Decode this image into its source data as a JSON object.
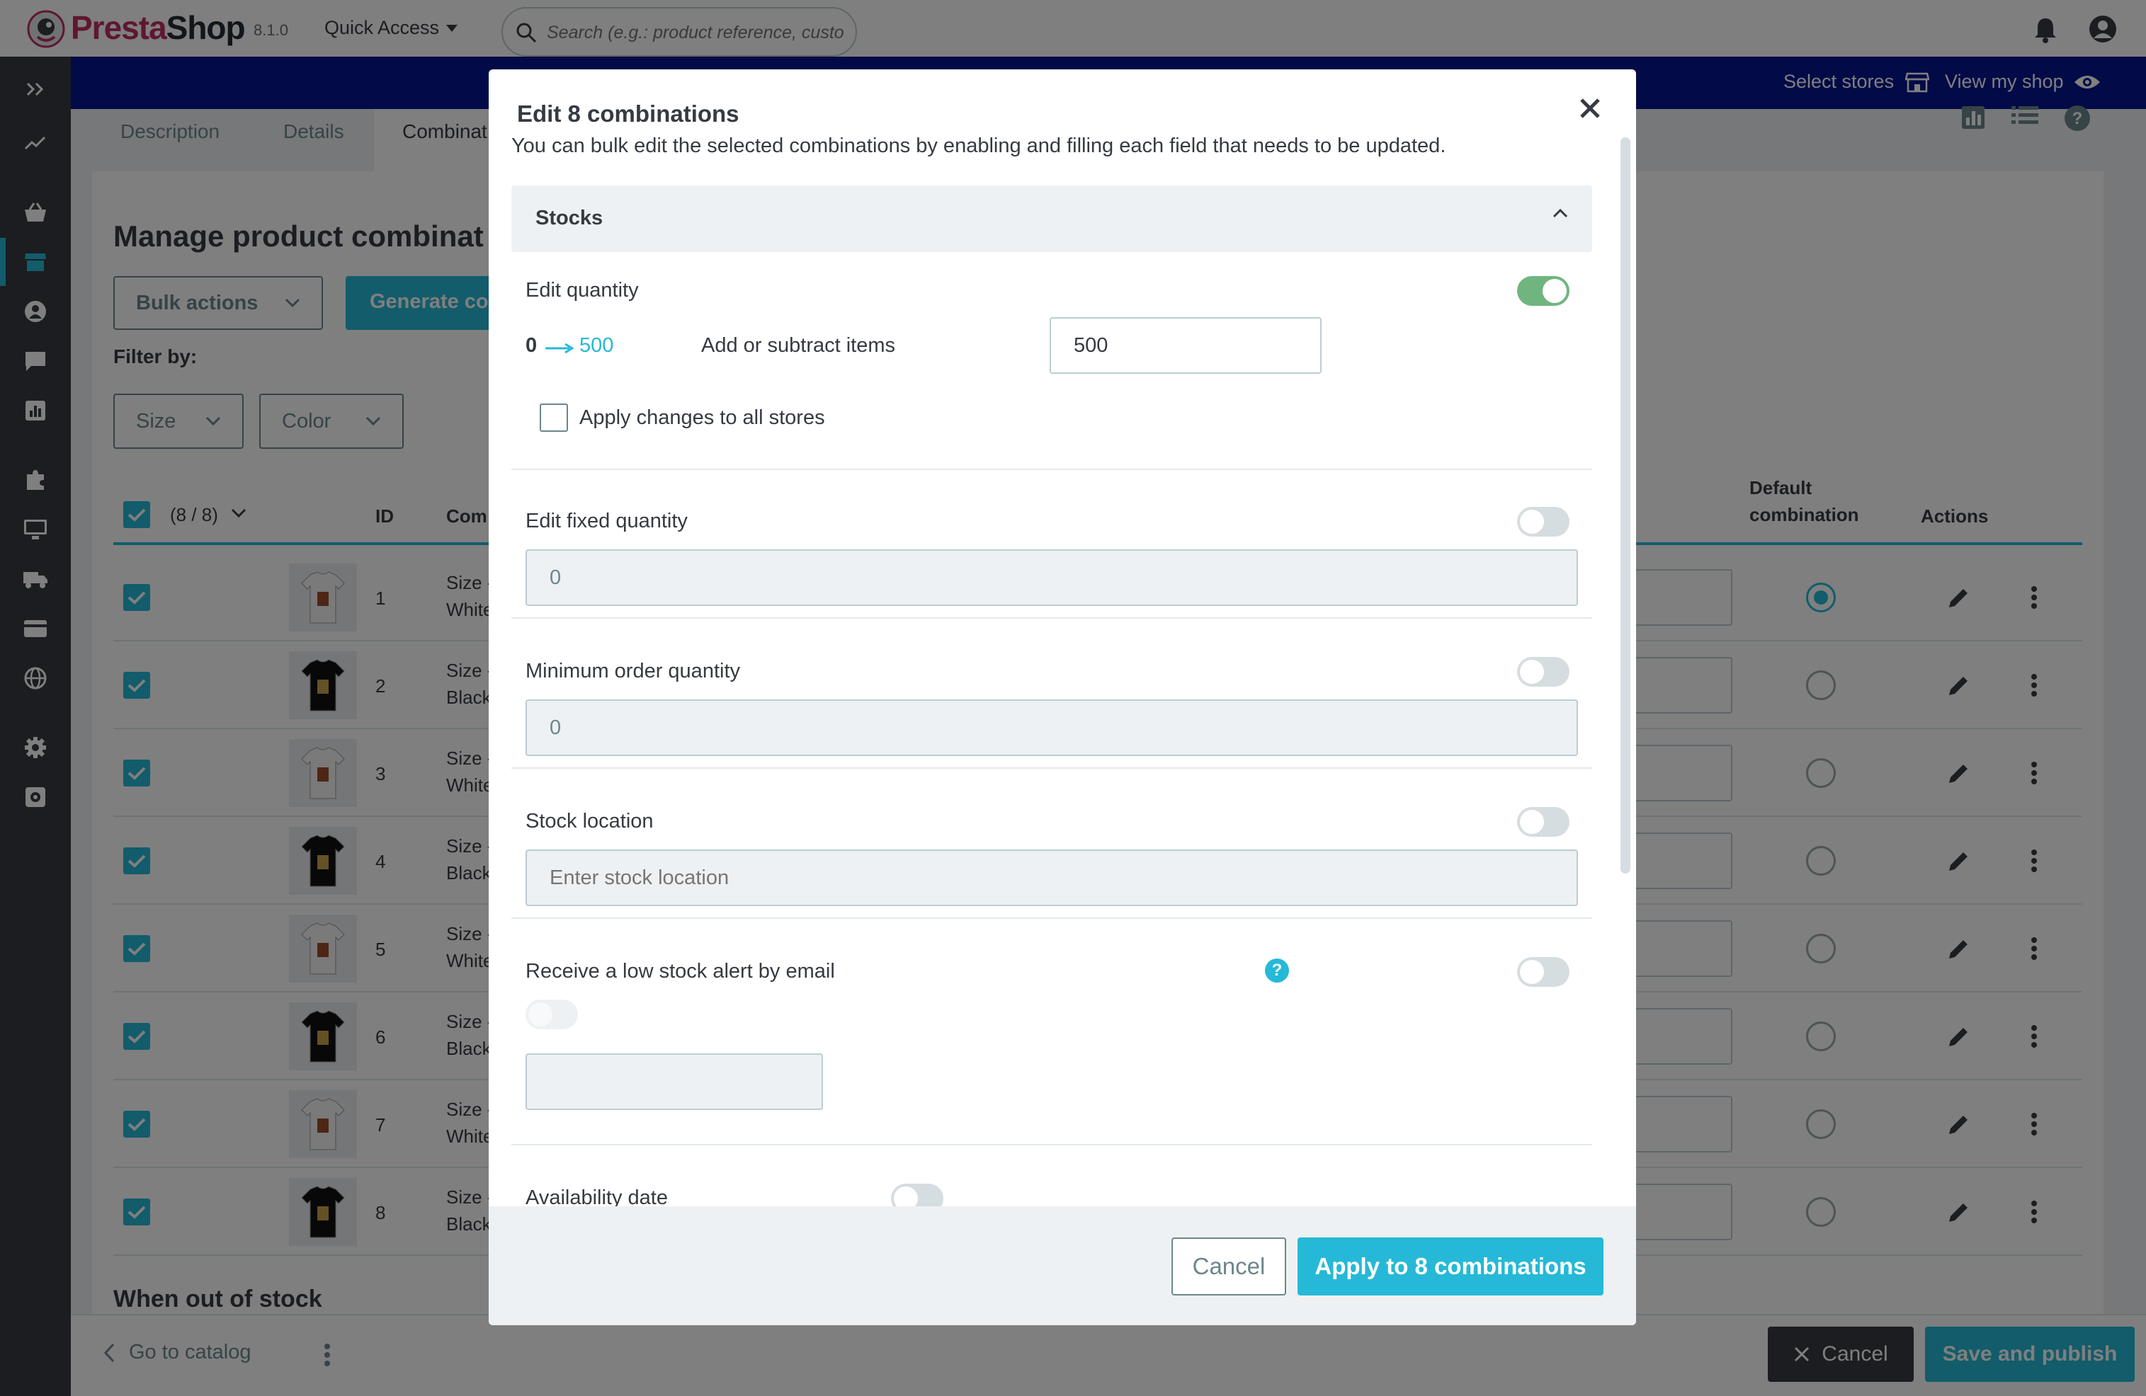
{
  "header": {
    "brand_presta": "Presta",
    "brand_shop": "Shop",
    "version": "8.1.0",
    "quick_access": "Quick Access",
    "search_placeholder": "Search (e.g.: product reference, custon"
  },
  "shopbar": {
    "select_stores": "Select stores",
    "view_my_shop": "View my shop"
  },
  "sidebar": {
    "icons": [
      "expand-icon",
      "stats-trend-icon",
      "orders-basket-icon",
      "catalog-store-icon",
      "customers-icon",
      "messages-icon",
      "stats-icon",
      "modules-puzzle-icon",
      "design-monitor-icon",
      "shipping-truck-icon",
      "payment-card-icon",
      "international-globe-icon",
      "settings-gear-icon",
      "advanced-parameters-icon"
    ]
  },
  "product_tabs": [
    "Description",
    "Details",
    "Combinat"
  ],
  "main": {
    "title": "Manage product combinat",
    "bulk_actions": "Bulk actions",
    "generate": "Generate co",
    "filter_by": "Filter by:",
    "filters": [
      "Size",
      "Color"
    ],
    "selection_count": "(8 / 8)",
    "columns": {
      "id": "ID",
      "combination": "Com",
      "default_combination_1": "Default",
      "default_combination_2": "combination",
      "actions": "Actions"
    },
    "rows": [
      {
        "id": "1",
        "line1": "Size -",
        "line2": "White",
        "shirt": "white",
        "default": true
      },
      {
        "id": "2",
        "line1": "Size -",
        "line2": "Black",
        "shirt": "black",
        "default": false
      },
      {
        "id": "3",
        "line1": "Size -",
        "line2": "White",
        "shirt": "white",
        "default": false
      },
      {
        "id": "4",
        "line1": "Size -",
        "line2": "Black",
        "shirt": "black",
        "default": false
      },
      {
        "id": "5",
        "line1": "Size -",
        "line2": "White",
        "shirt": "white",
        "default": false
      },
      {
        "id": "6",
        "line1": "Size -",
        "line2": "Black",
        "shirt": "black",
        "default": false
      },
      {
        "id": "7",
        "line1": "Size -",
        "line2": "White",
        "shirt": "white",
        "default": false
      },
      {
        "id": "8",
        "line1": "Size -",
        "line2": "Black",
        "shirt": "black",
        "default": false
      }
    ],
    "out_of_stock_title": "When out of stock"
  },
  "footer": {
    "go_to_catalog": "Go to catalog",
    "cancel": "Cancel",
    "save_and_publish": "Save and publish"
  },
  "modal": {
    "title": "Edit 8 combinations",
    "subtitle": "You can bulk edit the selected combinations by enabling and filling each field that needs to be updated.",
    "section": "Stocks",
    "edit_quantity": {
      "label": "Edit quantity",
      "enabled": true,
      "from": "0",
      "to": "500",
      "hint": "Add or subtract items",
      "value": "500"
    },
    "apply_all_stores": "Apply changes to all stores",
    "fixed_quantity": {
      "label": "Edit fixed quantity",
      "enabled": false,
      "value": "0"
    },
    "minimum_order": {
      "label": "Minimum order quantity",
      "enabled": false,
      "value": "0"
    },
    "stock_location": {
      "label": "Stock location",
      "enabled": false,
      "placeholder": "Enter stock location"
    },
    "low_stock_alert": {
      "label": "Receive a low stock alert by email",
      "enabled": false,
      "help": "?"
    },
    "availability_date": {
      "label": "Availability date",
      "enabled": false
    },
    "cancel": "Cancel",
    "apply": "Apply to 8 combinations"
  },
  "colors": {
    "brand_pink": "#bd2f62",
    "accent": "#25b9d7",
    "shopbar_blue": "#04148f",
    "sidebar_dark": "#363a41",
    "toggle_on": "#70b580"
  }
}
